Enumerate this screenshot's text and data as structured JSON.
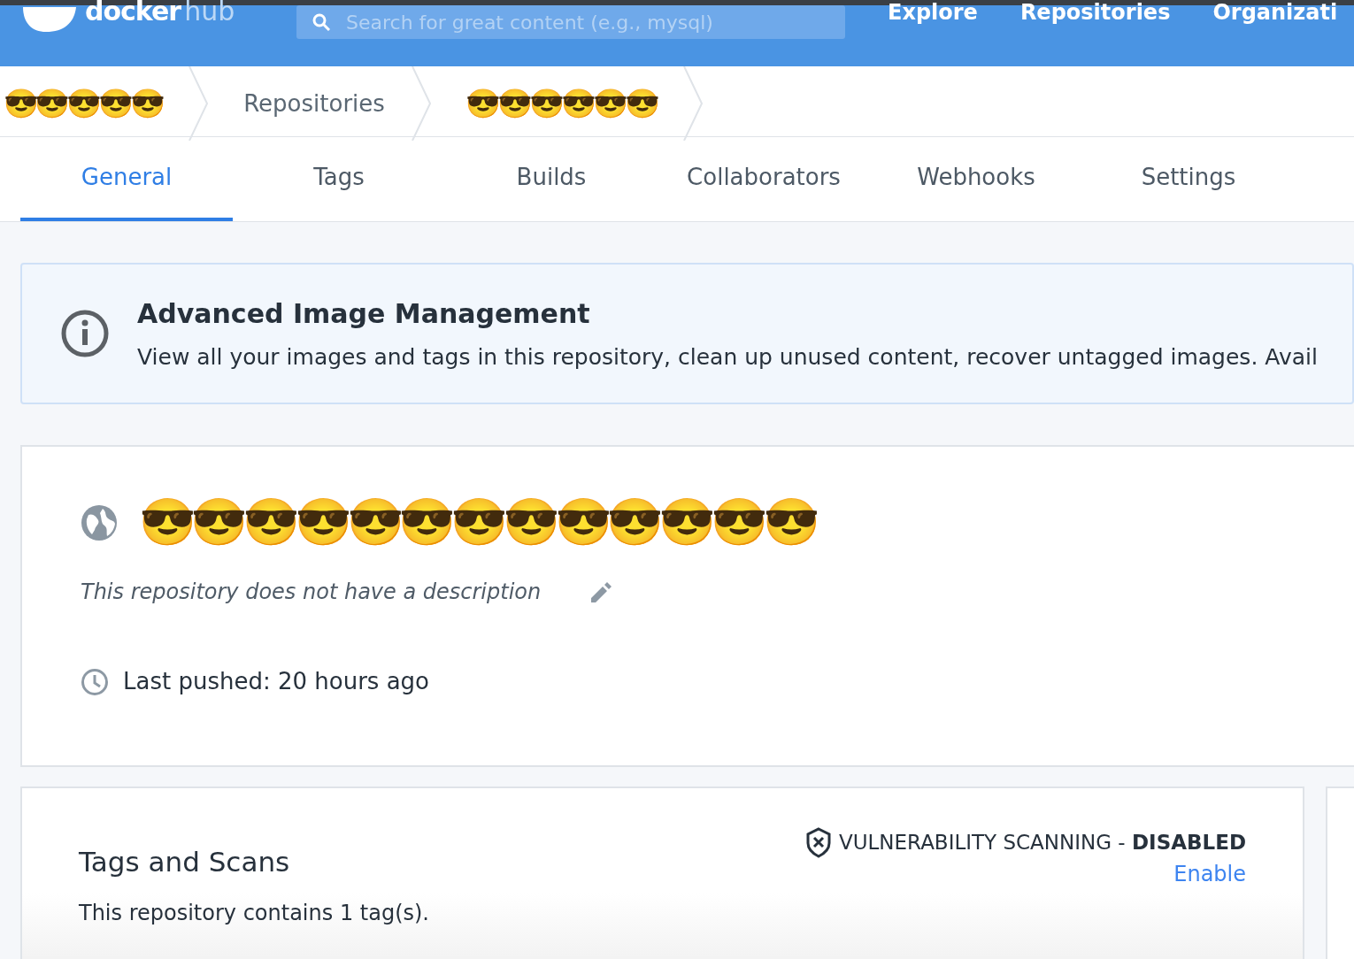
{
  "header": {
    "logo": {
      "word1": "docker",
      "word2": "hub"
    },
    "search": {
      "placeholder": "Search for great content (e.g., mysql)"
    },
    "nav": [
      "Explore",
      "Repositories",
      "Organizati"
    ]
  },
  "breadcrumbs": [
    {
      "kind": "masked",
      "text": "😎😎😎😎😎"
    },
    {
      "kind": "plain",
      "text": "Repositories"
    },
    {
      "kind": "masked",
      "text": "😎😎😎😎😎😎"
    }
  ],
  "tabs": [
    {
      "label": "General",
      "selected": true
    },
    {
      "label": "Tags",
      "selected": false
    },
    {
      "label": "Builds",
      "selected": false
    },
    {
      "label": "Collaborators",
      "selected": false
    },
    {
      "label": "Webhooks",
      "selected": false
    },
    {
      "label": "Settings",
      "selected": false
    }
  ],
  "banner": {
    "title": "Advanced Image Management",
    "text": "View all your images and tags in this repository, clean up unused content, recover untagged images. Avail"
  },
  "repository": {
    "name": "😎😎😎😎😎😎😎😎😎😎😎😎😎",
    "description": "This repository does not have a description",
    "last_pushed": "Last pushed: 20 hours ago"
  },
  "tags_and_scans": {
    "title": "Tags and Scans",
    "scanning_label": "VULNERABILITY SCANNING - ",
    "scanning_state": "DISABLED",
    "enable_link": "Enable",
    "summary": "This repository contains 1 tag(s)."
  }
}
